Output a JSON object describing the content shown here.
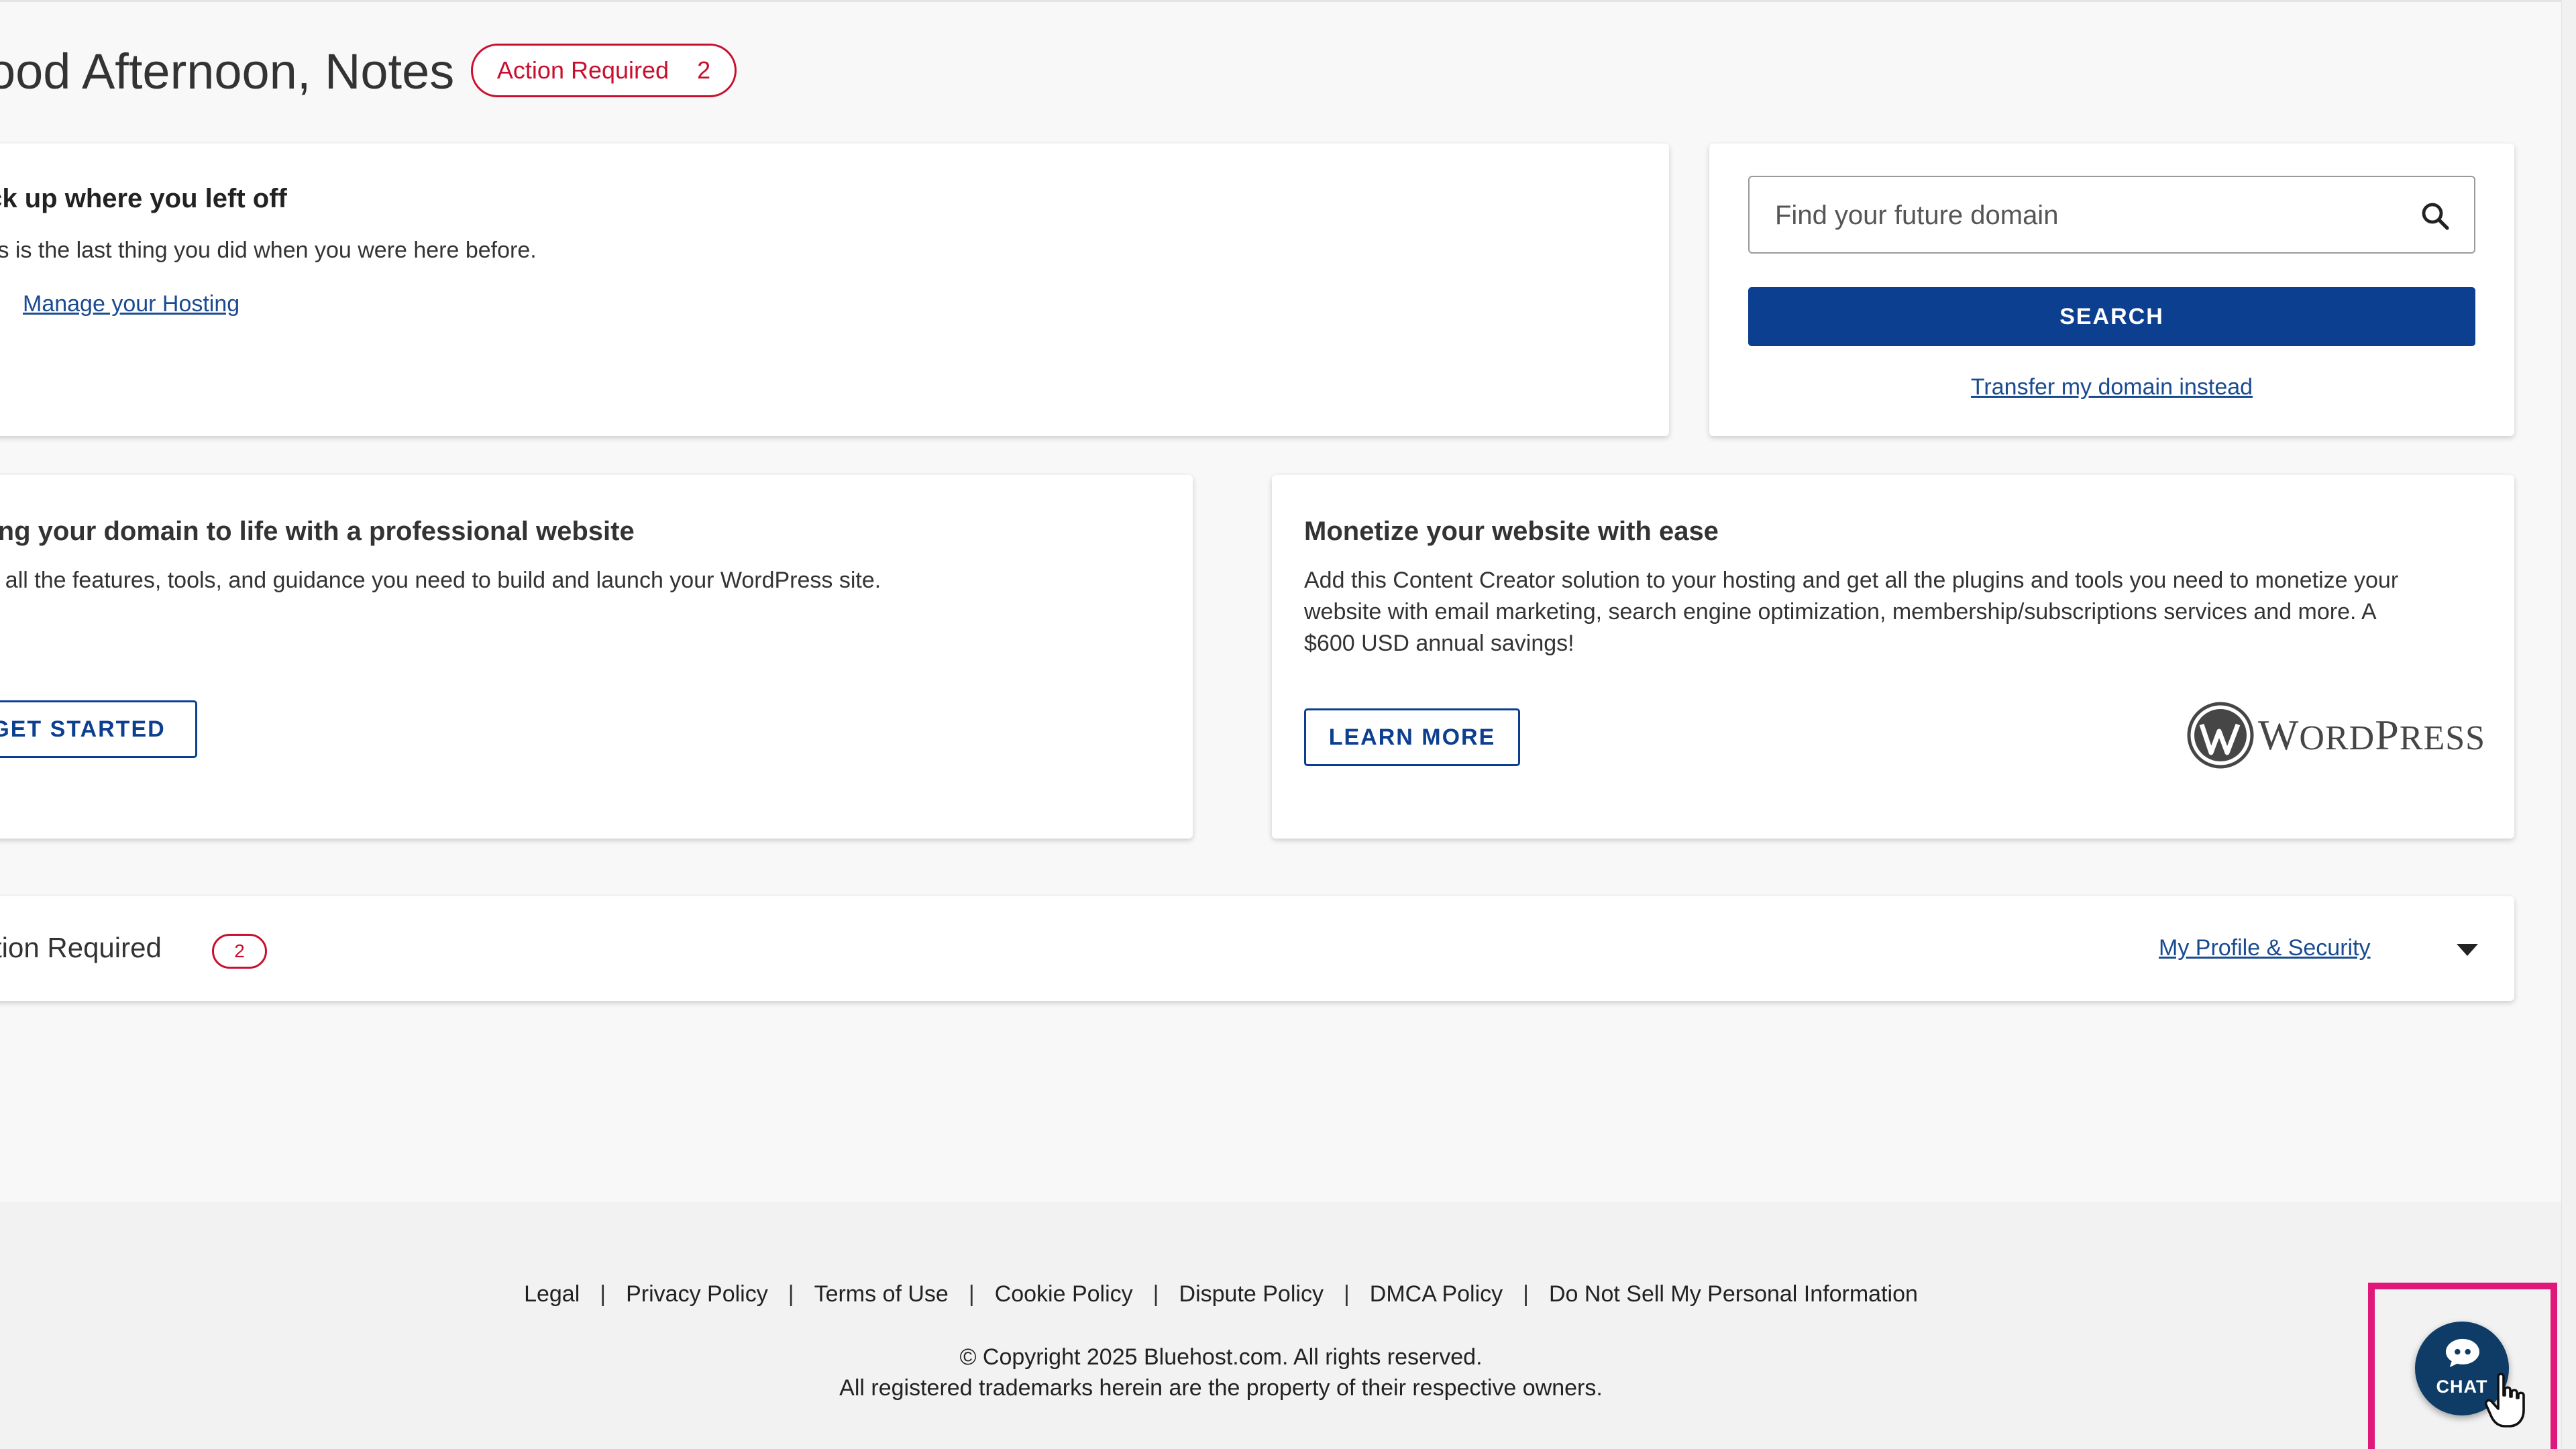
{
  "greeting": {
    "text": "ood Afternoon, Notes"
  },
  "action_pill": {
    "label": "Action Required",
    "count": "2"
  },
  "resume_card": {
    "heading": "ick up where you left off",
    "body": "his is the last thing you did when you were here before.",
    "link": "Manage your Hosting"
  },
  "domain_search": {
    "placeholder": "Find your future domain",
    "button": "SEARCH",
    "transfer_link": "Transfer my domain instead"
  },
  "website_card": {
    "heading": "ring your domain to life with a professional website",
    "body": "et all the features, tools, and guidance you need to build and launch your WordPress site.",
    "button": "GET STARTED"
  },
  "monetize_card": {
    "heading": "Monetize your website with ease",
    "body": "Add this Content Creator solution to your hosting and get all the plugins and tools you need to monetize your website with email marketing, search engine optimization, membership/subscriptions services and more. A $600 USD annual savings!",
    "button": "LEARN MORE",
    "logo_text": "WordPress"
  },
  "action_required_panel": {
    "title": "ction Required",
    "count": "2",
    "profile_link": "My Profile & Security"
  },
  "footer": {
    "links": [
      "Legal",
      "Privacy Policy",
      "Terms of Use",
      "Cookie Policy",
      "Dispute Policy",
      "DMCA Policy",
      "Do Not Sell My Personal Information"
    ],
    "separator": "|",
    "copyright": "© Copyright 2025 Bluehost.com. All rights reserved.",
    "trademark": "All registered trademarks herein are the property of their respective owners."
  },
  "chat": {
    "label": "CHAT"
  },
  "colors": {
    "brand_blue": "#0c3f90",
    "link_blue": "#1a4b91",
    "alert_red": "#c8102e",
    "highlight_pink": "#e0187a"
  },
  "icons": [
    "chevron-right-icon",
    "search-icon",
    "wordpress-logo-icon",
    "caret-down-icon",
    "chat-bubble-icon",
    "hand-cursor-icon"
  ]
}
